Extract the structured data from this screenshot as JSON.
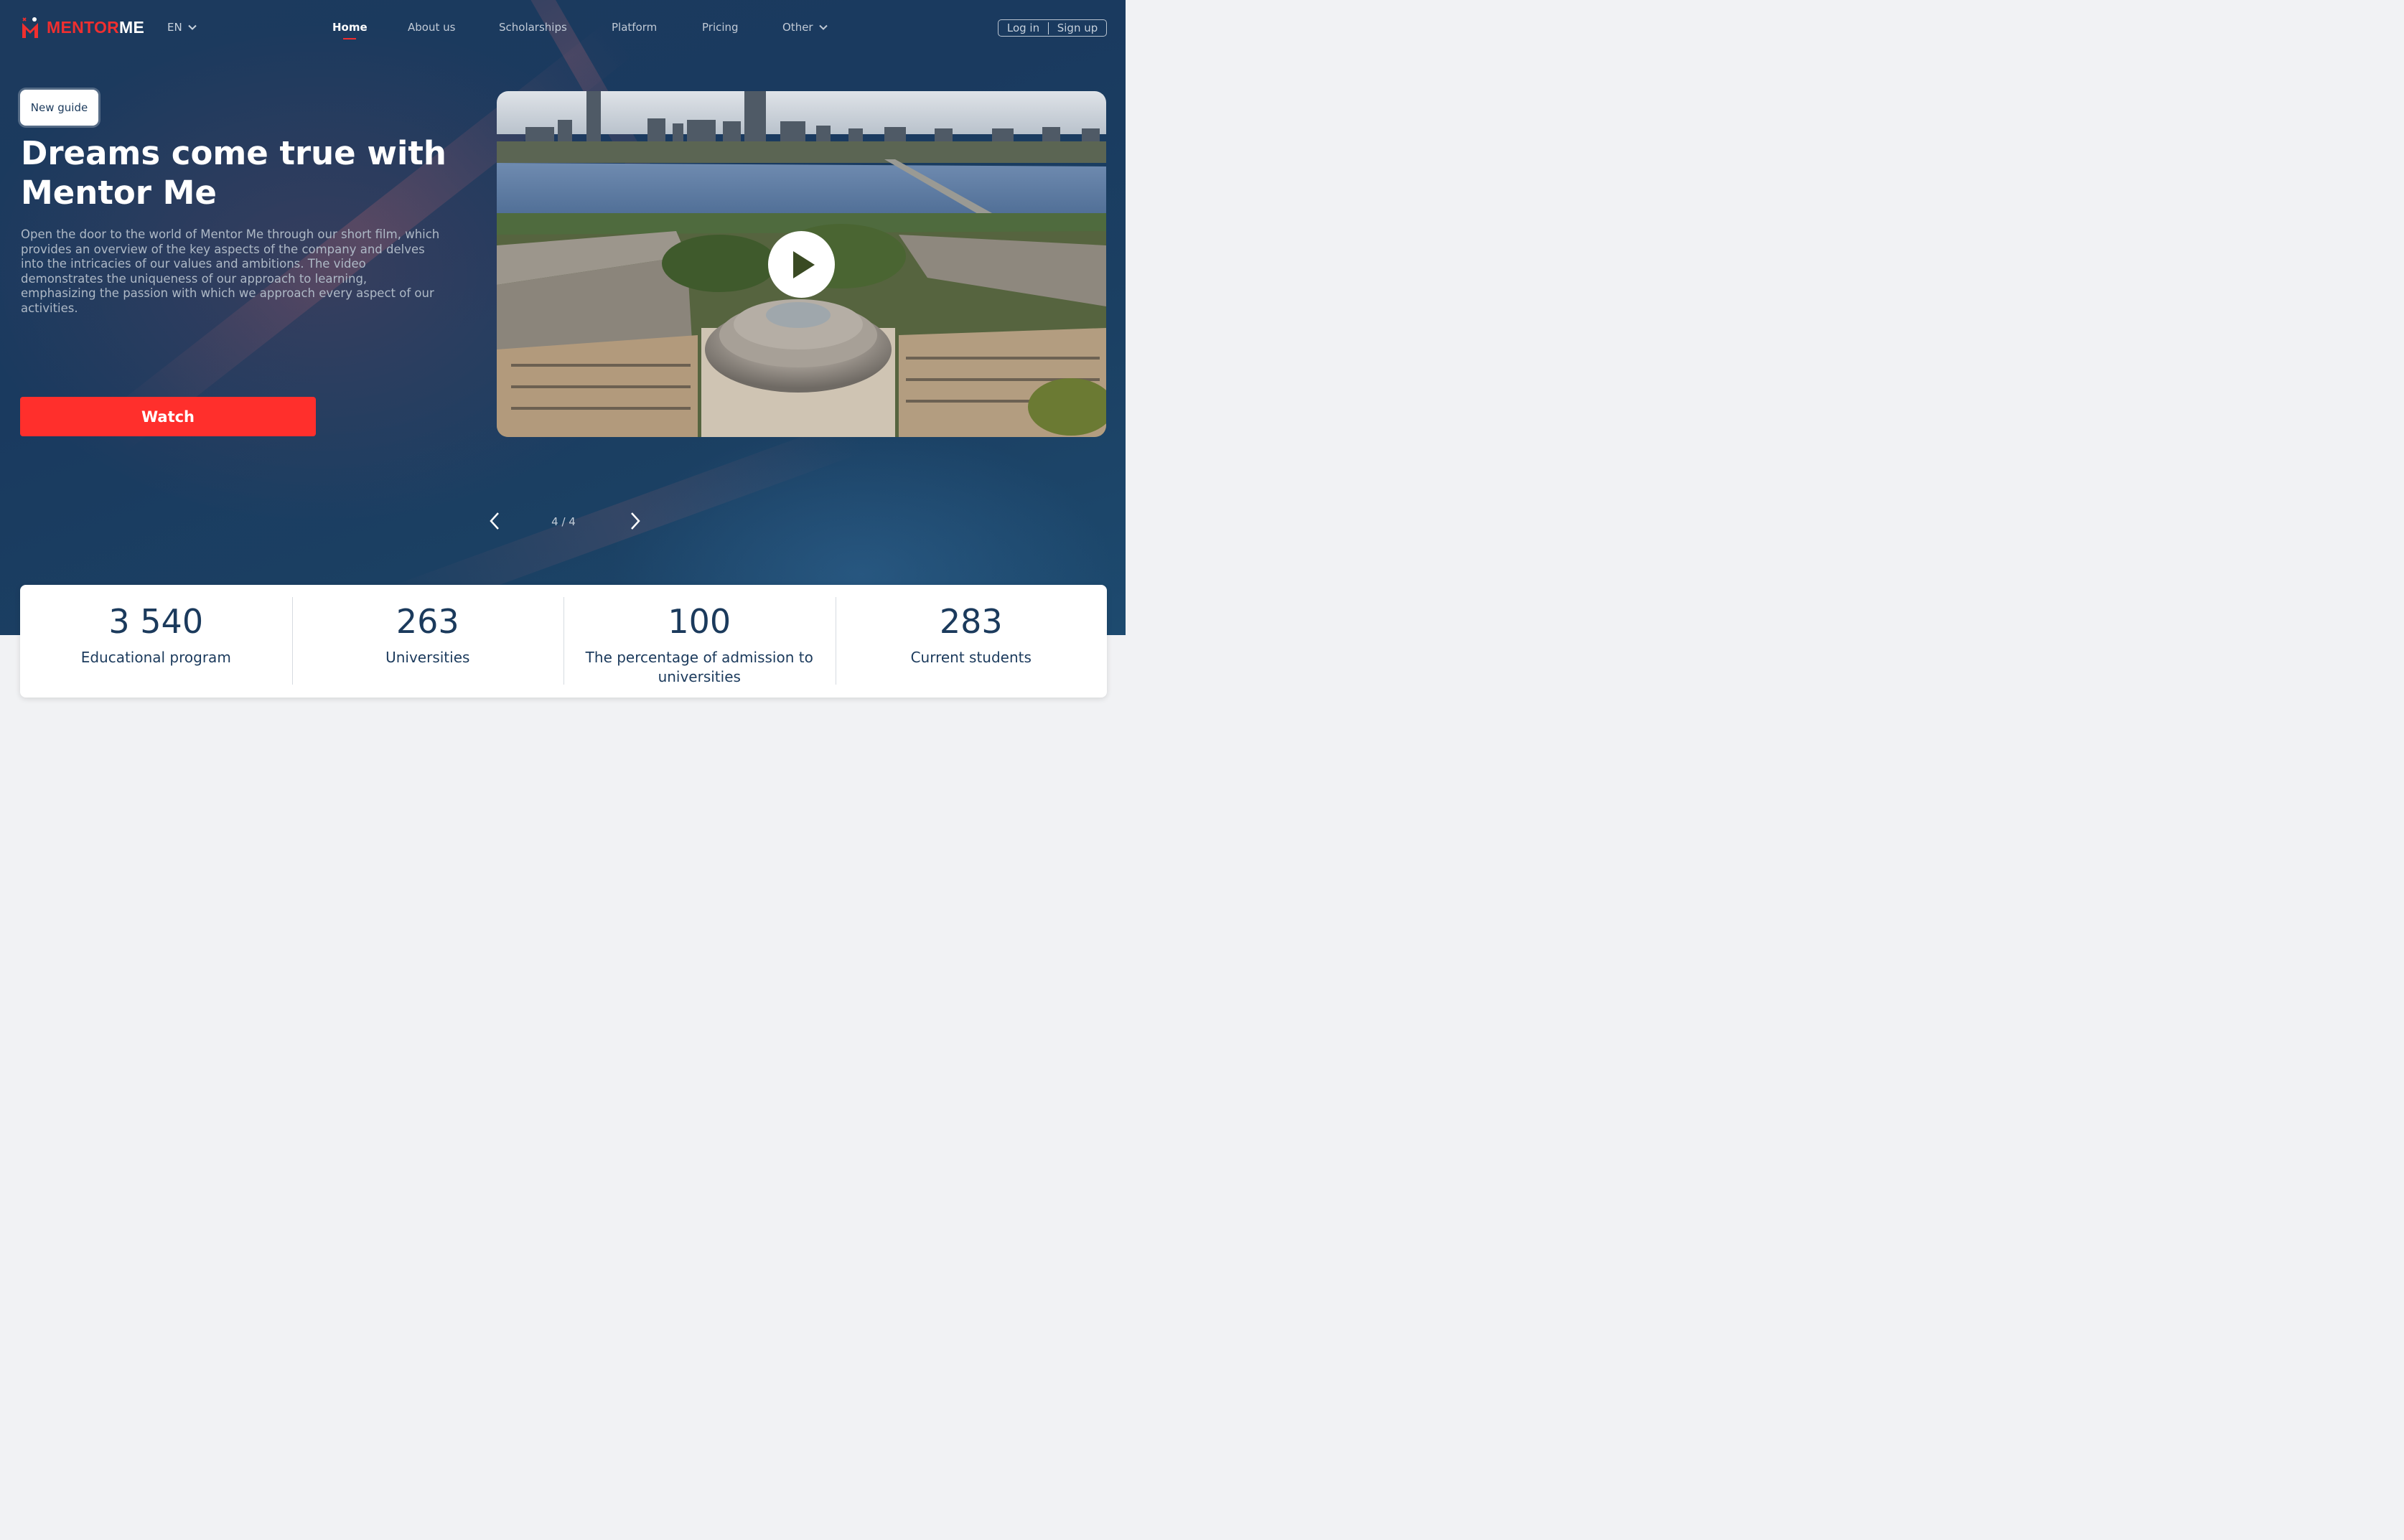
{
  "brand": {
    "name_part1": "MENTOR",
    "name_part2": "ME",
    "accent": "#f02f2f",
    "navy": "#1b3a5c"
  },
  "header": {
    "language": "EN",
    "menu": [
      {
        "label": "Home",
        "active": true
      },
      {
        "label": "About us"
      },
      {
        "label": "Scholarships"
      },
      {
        "label": "Platform"
      },
      {
        "label": "Pricing"
      },
      {
        "label": "Other",
        "has_dropdown": true
      }
    ],
    "login_label": "Log in",
    "signup_label": "Sign up"
  },
  "hero": {
    "badge": "New guide",
    "title": "Dreams come true with Mentor Me",
    "description": "Open the door to the world of Mentor Me through our short film, which provides an overview of the key aspects of the company and delves into the intricacies of our values and ambitions. The video demonstrates the uniqueness of our approach to learning, emphasizing the passion with which we approach every aspect of our activities.",
    "cta": "Watch"
  },
  "video": {
    "play_icon": "play-icon"
  },
  "pager": {
    "counter": "4 / 4",
    "prev_icon": "chevron-left-icon",
    "next_icon": "chevron-right-icon"
  },
  "stats": [
    {
      "value": "3 540",
      "label": "Educational program"
    },
    {
      "value": "263",
      "label": "Universities"
    },
    {
      "value": "100",
      "label": "The percentage of admission to universities"
    },
    {
      "value": "283",
      "label": "Current students"
    }
  ]
}
